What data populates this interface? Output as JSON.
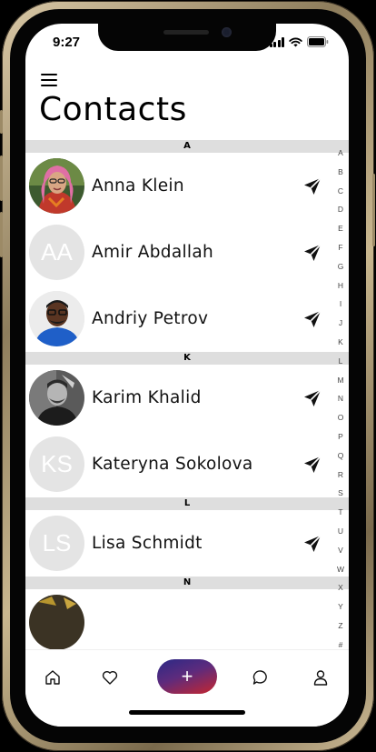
{
  "status_bar": {
    "time": "9:27"
  },
  "header": {
    "title": "Contacts",
    "menu_icon": "hamburger-menu-icon"
  },
  "sections": [
    {
      "letter": "A",
      "contacts": [
        {
          "name": "Anna Klein",
          "avatar_type": "photo",
          "avatar_initials": "",
          "photo": "woman-pink-hair"
        },
        {
          "name": "Amir Abdallah",
          "avatar_type": "initials",
          "avatar_initials": "AA"
        },
        {
          "name": "Andriy Petrov",
          "avatar_type": "photo",
          "avatar_initials": "",
          "photo": "man-glasses-blue-shirt"
        }
      ]
    },
    {
      "letter": "K",
      "contacts": [
        {
          "name": "Karim Khalid",
          "avatar_type": "photo",
          "avatar_initials": "",
          "photo": "man-black-white"
        },
        {
          "name": "Kateryna Sokolova",
          "avatar_type": "initials",
          "avatar_initials": "KS"
        }
      ]
    },
    {
      "letter": "L",
      "contacts": [
        {
          "name": "Lisa Schmidt",
          "avatar_type": "initials",
          "avatar_initials": "LS"
        }
      ]
    },
    {
      "letter": "N",
      "contacts": []
    }
  ],
  "alphabet_index": [
    "A",
    "B",
    "C",
    "D",
    "E",
    "F",
    "G",
    "H",
    "I",
    "J",
    "K",
    "L",
    "M",
    "N",
    "O",
    "P",
    "Q",
    "R",
    "S",
    "T",
    "U",
    "V",
    "W",
    "X",
    "Y",
    "Z",
    "#"
  ],
  "bottom_nav": {
    "items": [
      "home-icon",
      "heart-icon",
      "add-button",
      "chat-bubble-icon",
      "person-icon"
    ],
    "add_label": "+"
  },
  "colors": {
    "accent_gradient_start": "#2b2a86",
    "accent_gradient_end": "#c6262f",
    "section_header_bg": "#dedede",
    "initials_avatar_bg": "#e4e4e4"
  }
}
